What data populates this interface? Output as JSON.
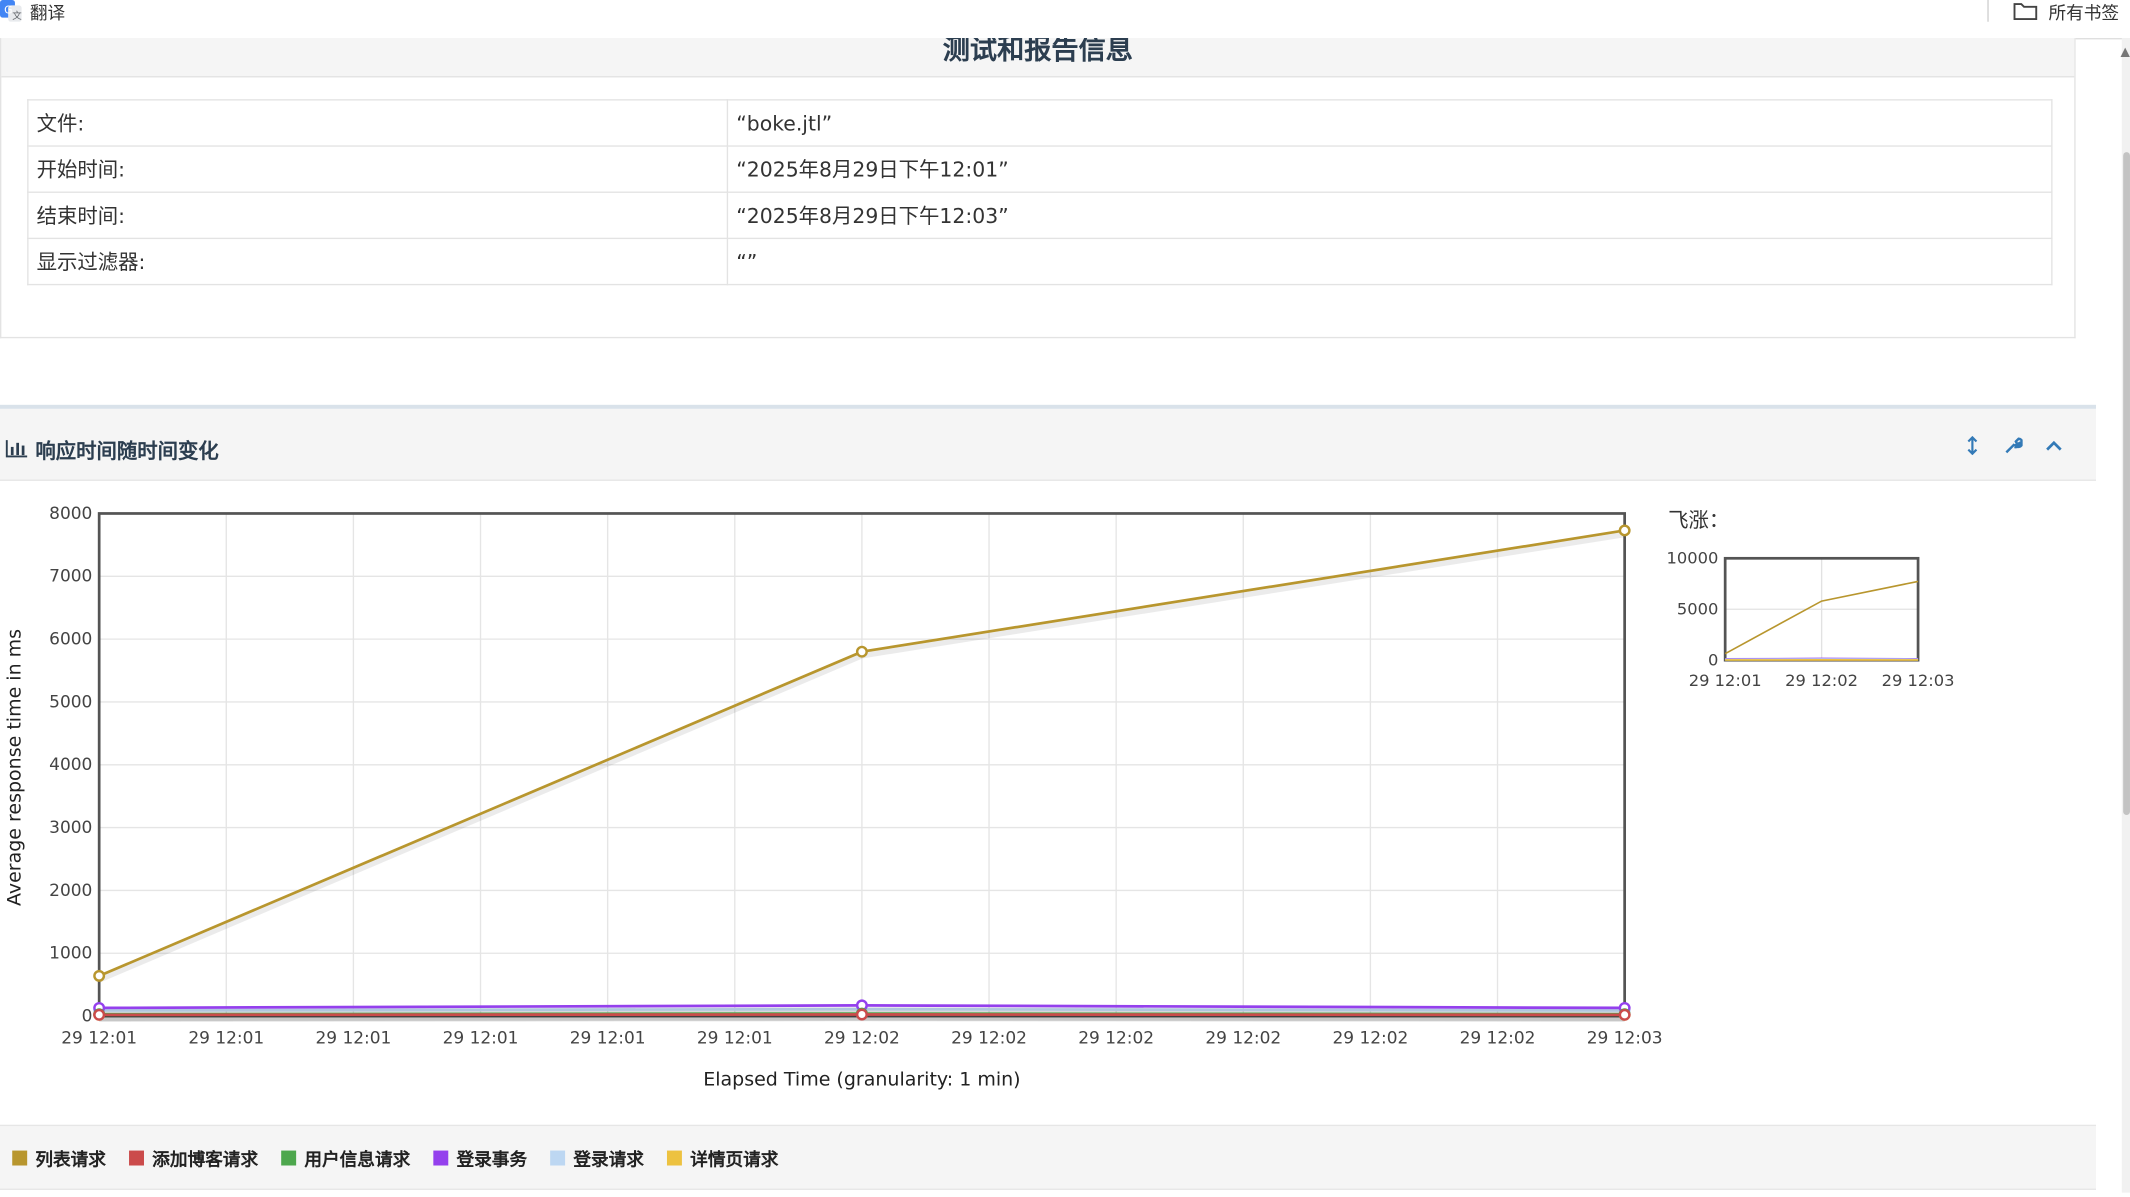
{
  "browser": {
    "translate_label": "翻译",
    "bookmarks_label": "所有书签"
  },
  "test_info": {
    "heading": "测试和报告信息",
    "rows": [
      {
        "key": "文件:",
        "value": "“boke.jtl”"
      },
      {
        "key": "开始时间:",
        "value": "“2025年8月29日下午12:01”"
      },
      {
        "key": "结束时间:",
        "value": "“2025年8月29日下午12:03”"
      },
      {
        "key": "显示过滤器:",
        "value": "“”"
      }
    ]
  },
  "chart_panel": {
    "title": "响应时间随时间变化",
    "tools": [
      "resize-icon",
      "wrench-icon",
      "collapse-icon"
    ],
    "overview_label": "飞涨："
  },
  "chart_data": {
    "type": "line",
    "xlabel": "Elapsed Time (granularity: 1 min)",
    "ylabel": "Average response time in ms",
    "ylim": [
      0,
      8000
    ],
    "yticks": [
      0,
      1000,
      2000,
      3000,
      4000,
      5000,
      6000,
      7000,
      8000
    ],
    "x_tick_labels": [
      "29 12:01",
      "29 12:01",
      "29 12:01",
      "29 12:01",
      "29 12:01",
      "29 12:01",
      "29 12:02",
      "29 12:02",
      "29 12:02",
      "29 12:02",
      "29 12:02",
      "29 12:02",
      "29 12:03"
    ],
    "x_points": [
      0,
      6,
      12
    ],
    "series": [
      {
        "name": "列表请求",
        "color": "#b8962e",
        "values": [
          640,
          5800,
          7730
        ]
      },
      {
        "name": "添加博客请求",
        "color": "#cb4b4b",
        "values": [
          20,
          25,
          20
        ]
      },
      {
        "name": "用户信息请求",
        "color": "#4da74d",
        "values": [
          30,
          40,
          30
        ]
      },
      {
        "name": "登录事务",
        "color": "#9440ed",
        "values": [
          130,
          170,
          130
        ]
      },
      {
        "name": "登录请求",
        "color": "#bdd7f2",
        "values": [
          90,
          110,
          90
        ]
      },
      {
        "name": "详情页请求",
        "color": "#edc240",
        "values": [
          20,
          30,
          20
        ]
      }
    ],
    "overview": {
      "ylim": [
        0,
        10000
      ],
      "yticks": [
        0,
        5000,
        10000
      ],
      "x_tick_labels": [
        "29 12:01",
        "29 12:02",
        "29 12:03"
      ]
    }
  }
}
